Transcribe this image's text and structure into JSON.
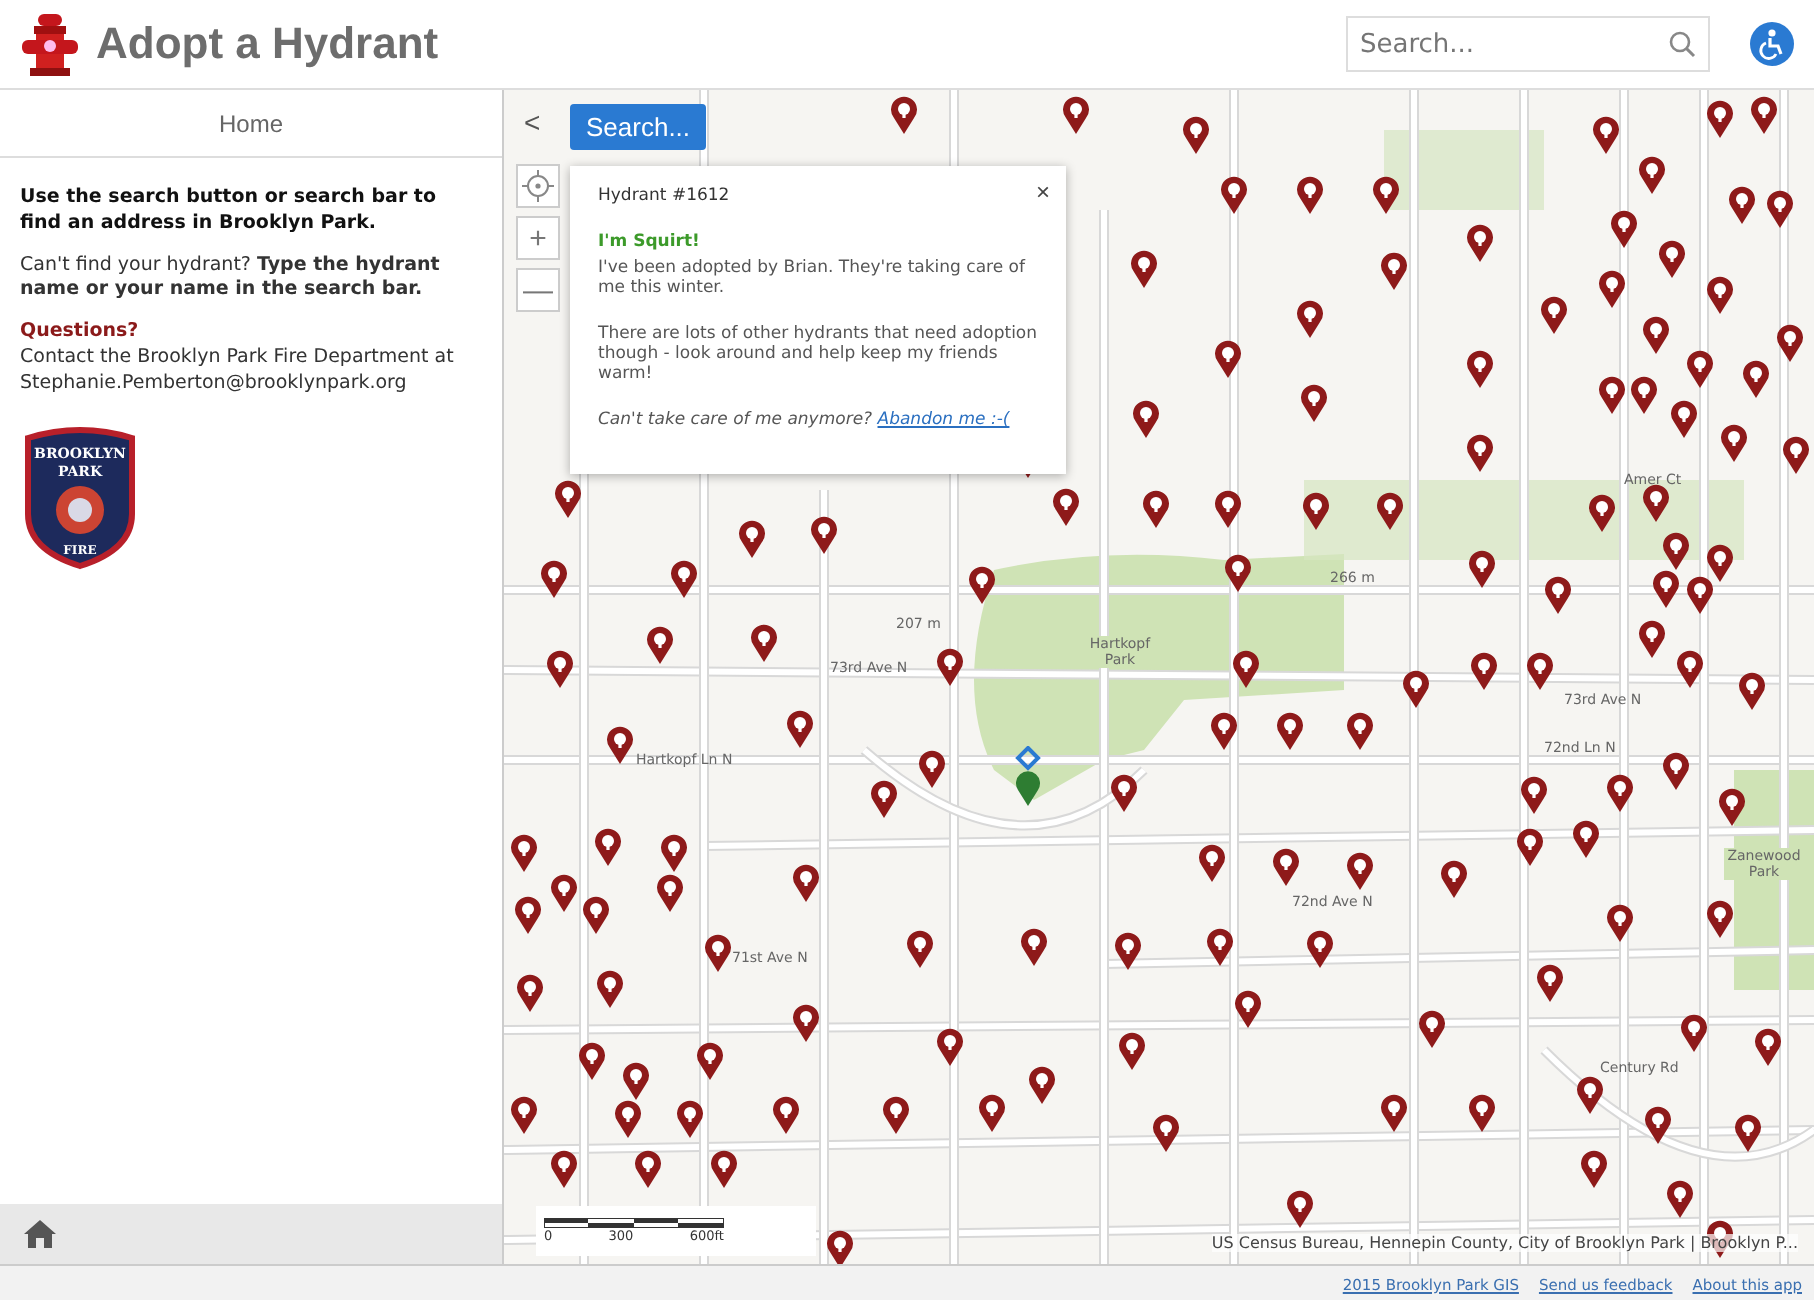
{
  "header": {
    "title": "Adopt a Hydrant",
    "search": {
      "placeholder": "Search..."
    }
  },
  "sidebar": {
    "tab": "Home",
    "intro": "Use the search button or search bar to find an address in Brooklyn Park.",
    "hint": "Can't find your hydrant? **Type the hydrant name or your name in the search bar.**",
    "questions_title": "Questions?",
    "contact": "Contact the Brooklyn Park Fire Department at Stephanie.Pemberton@brooklynpark.org",
    "badge": {
      "top": "BROOKLYN",
      "middle": "PARK",
      "bottom": "FIRE"
    }
  },
  "map": {
    "collapse_button": "<",
    "search_button": "Search...",
    "zoom_in": "+",
    "zoom_out": "—",
    "labels": [
      "73rd Ave N",
      "72nd Ln N",
      "73rd Ave N",
      "Hartkopf Ln N",
      "71st Ave N",
      "72nd Ave N",
      "Century Rd",
      "207 m",
      "266 m",
      "Hartkopf Park",
      "Zanewood Park",
      "Amer Ct"
    ],
    "popup": {
      "title": "Hydrant #1612",
      "close": "×",
      "name": "I'm Squirt!",
      "adopted": "I've been adopted by Brian. They're taking care of me this winter.",
      "others": "There are lots of other hydrants that need adoption though - look around and help keep my friends warm!",
      "question": "Can't take care of me anymore?",
      "link": "Abandon me :-("
    },
    "scale": {
      "ticks": [
        "0",
        "300",
        "600ft"
      ]
    },
    "attribution": "US Census Bureau, Hennepin County, City of Brooklyn Park | Brooklyn P..."
  },
  "footer": {
    "links": [
      "2015 Brooklyn Park GIS",
      "Send us feedback",
      "About this app"
    ]
  }
}
